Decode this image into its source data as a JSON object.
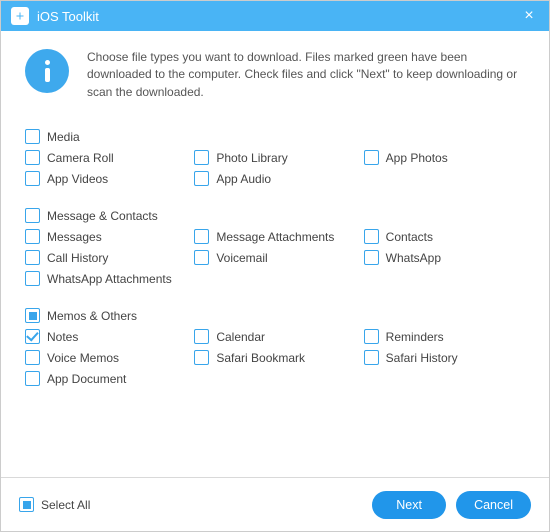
{
  "titlebar": {
    "app_name": "iOS Toolkit"
  },
  "info": {
    "text": "Choose file types you want to download. Files marked green have been downloaded to the computer. Check files and click \"Next\" to keep downloading or scan the downloaded."
  },
  "groups": [
    {
      "name": "media",
      "header": {
        "label": "Media",
        "state": "unchecked"
      },
      "items": [
        {
          "label": "Camera Roll",
          "state": "unchecked"
        },
        {
          "label": "Photo Library",
          "state": "unchecked"
        },
        {
          "label": "App Photos",
          "state": "unchecked"
        },
        {
          "label": "App Videos",
          "state": "unchecked"
        },
        {
          "label": "App Audio",
          "state": "unchecked"
        }
      ]
    },
    {
      "name": "message-contacts",
      "header": {
        "label": "Message & Contacts",
        "state": "unchecked"
      },
      "items": [
        {
          "label": "Messages",
          "state": "unchecked"
        },
        {
          "label": "Message Attachments",
          "state": "unchecked"
        },
        {
          "label": "Contacts",
          "state": "unchecked"
        },
        {
          "label": "Call History",
          "state": "unchecked"
        },
        {
          "label": "Voicemail",
          "state": "unchecked"
        },
        {
          "label": "WhatsApp",
          "state": "unchecked"
        },
        {
          "label": "WhatsApp Attachments",
          "state": "unchecked"
        }
      ]
    },
    {
      "name": "memos-others",
      "header": {
        "label": "Memos & Others",
        "state": "partial"
      },
      "items": [
        {
          "label": "Notes",
          "state": "checked"
        },
        {
          "label": "Calendar",
          "state": "unchecked"
        },
        {
          "label": "Reminders",
          "state": "unchecked"
        },
        {
          "label": "Voice Memos",
          "state": "unchecked"
        },
        {
          "label": "Safari Bookmark",
          "state": "unchecked"
        },
        {
          "label": "Safari History",
          "state": "unchecked"
        },
        {
          "label": "App Document",
          "state": "unchecked"
        }
      ]
    }
  ],
  "footer": {
    "select_all": {
      "label": "Select All",
      "state": "partial"
    },
    "next_label": "Next",
    "cancel_label": "Cancel"
  },
  "colors": {
    "accent": "#38a5eb",
    "titlebar": "#49b4f5",
    "button": "#2196ea"
  }
}
